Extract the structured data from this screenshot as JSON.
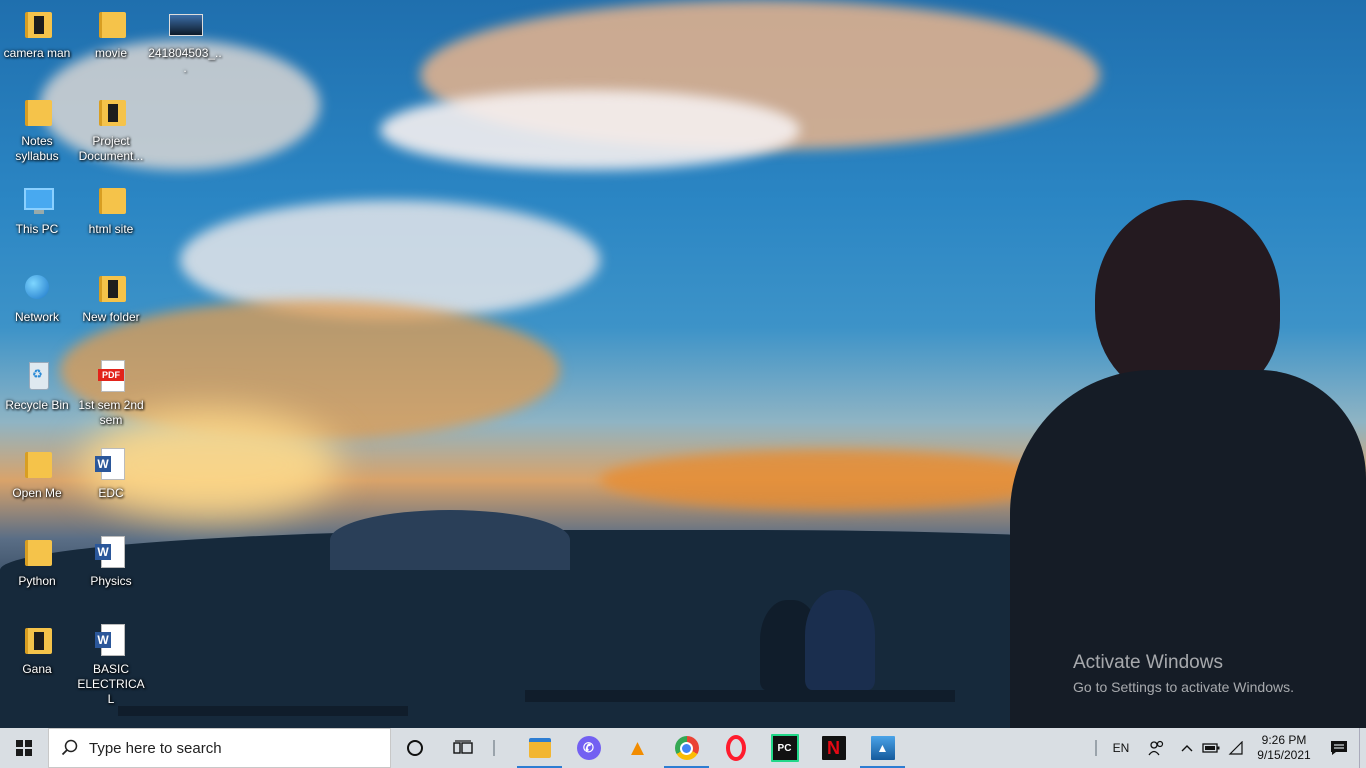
{
  "desktop": {
    "icons": [
      {
        "label": "camera man",
        "icon": "folder-icon"
      },
      {
        "label": "movie",
        "icon": "folder-icon"
      },
      {
        "label": "241804503_...",
        "icon": "image-file-icon"
      },
      {
        "label": "Notes syllabus",
        "icon": "folder-icon"
      },
      {
        "label": "Project Document...",
        "icon": "folder-icon"
      },
      {
        "label": "This PC",
        "icon": "computer-icon"
      },
      {
        "label": "html site",
        "icon": "folder-icon"
      },
      {
        "label": "Network",
        "icon": "network-icon"
      },
      {
        "label": "New folder",
        "icon": "folder-icon"
      },
      {
        "label": "Recycle Bin",
        "icon": "recycle-bin-icon"
      },
      {
        "label": "1st sem 2nd sem",
        "icon": "pdf-file-icon"
      },
      {
        "label": "Open Me",
        "icon": "folder-icon"
      },
      {
        "label": "EDC",
        "icon": "word-document-icon"
      },
      {
        "label": "Python",
        "icon": "folder-icon"
      },
      {
        "label": "Physics",
        "icon": "word-document-icon"
      },
      {
        "label": "Gana",
        "icon": "folder-icon"
      },
      {
        "label": "BASIC ELECTRICAL",
        "icon": "word-document-icon"
      }
    ]
  },
  "watermark": {
    "title": "Activate Windows",
    "subtitle": "Go to Settings to activate Windows."
  },
  "taskbar": {
    "search_placeholder": "Type here to search",
    "apps": [
      {
        "name": "File Explorer",
        "icon": "file-explorer-icon",
        "color": "#f2b632",
        "glyph": ""
      },
      {
        "name": "Viber",
        "icon": "viber-icon",
        "color": "#7360f2",
        "glyph": "✆"
      },
      {
        "name": "VLC",
        "icon": "vlc-icon",
        "color": "#f28c00",
        "glyph": "▲"
      },
      {
        "name": "Chrome",
        "icon": "chrome-icon",
        "color": "#34a853",
        "glyph": "●"
      },
      {
        "name": "Opera",
        "icon": "opera-icon",
        "color": "#ff1b2d",
        "glyph": "O"
      },
      {
        "name": "PyCharm",
        "icon": "pycharm-icon",
        "color": "#1a1a1a",
        "glyph": "PC"
      },
      {
        "name": "Netflix",
        "icon": "netflix-icon",
        "color": "#111111",
        "glyph": "N"
      },
      {
        "name": "Photos",
        "icon": "photos-icon",
        "color": "#1e6fc0",
        "glyph": "▲"
      }
    ],
    "tray": {
      "language": "EN",
      "time": "9:26 PM",
      "date": "9/15/2021"
    }
  }
}
